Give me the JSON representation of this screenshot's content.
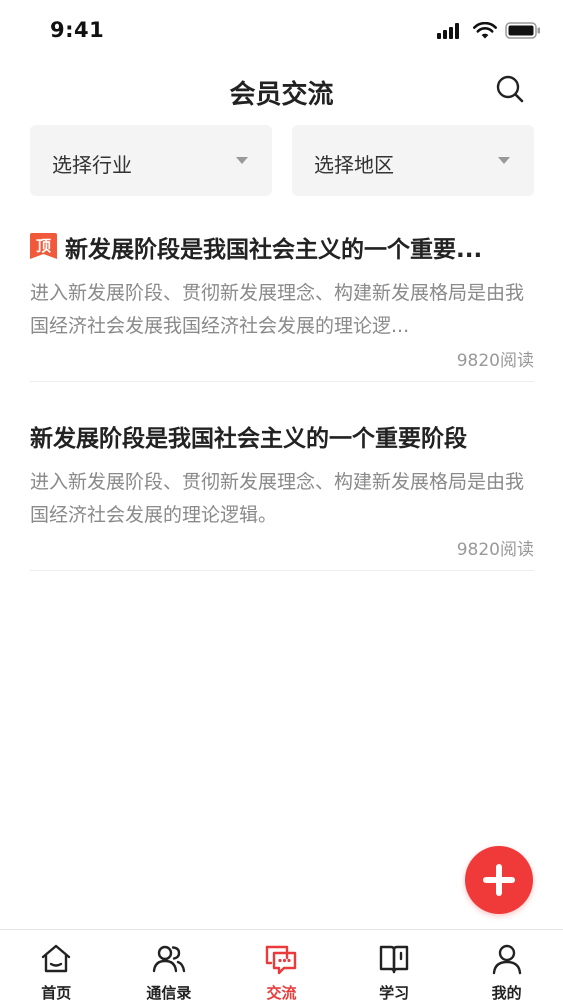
{
  "status_bar": {
    "time": "9:41"
  },
  "header": {
    "title": "会员交流"
  },
  "filters": [
    {
      "label": "选择行业"
    },
    {
      "label": "选择地区"
    }
  ],
  "articles": [
    {
      "pinned": true,
      "pin_label": "顶",
      "title": "新发展阶段是我国社会主义的一个重要...",
      "summary": "进入新发展阶段、贯彻新发展理念、构建新发展格局是由我国经济社会发展我国经济社会发展的理论逻...",
      "reads": "9820阅读"
    },
    {
      "pinned": false,
      "title": "新发展阶段是我国社会主义的一个重要阶段",
      "summary": "进入新发展阶段、贯彻新发展理念、构建新发展格局是由我国经济社会发展的理论逻辑。",
      "reads": "9820阅读"
    }
  ],
  "tabbar": [
    {
      "label": "首页",
      "icon": "home-icon",
      "active": false
    },
    {
      "label": "通信录",
      "icon": "contacts-icon",
      "active": false
    },
    {
      "label": "交流",
      "icon": "chat-icon",
      "active": true
    },
    {
      "label": "学习",
      "icon": "book-icon",
      "active": false
    },
    {
      "label": "我的",
      "icon": "user-icon",
      "active": false
    }
  ],
  "colors": {
    "accent": "#e93b3b",
    "fab": "#f03a3a",
    "pin_badge": "#f0593a"
  }
}
